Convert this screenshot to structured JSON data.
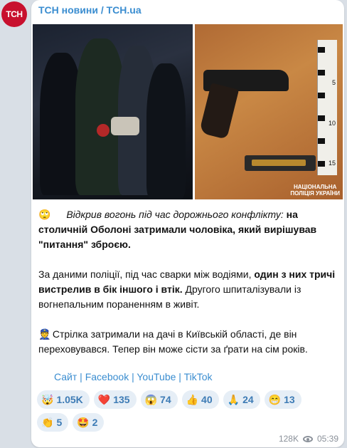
{
  "channel": {
    "avatar_text": "ТСН",
    "name": "ТСН новини / TCH.ua"
  },
  "photos": {
    "watermark": "НАЦІОНАЛЬНА\nПОЛІЦІЯ УКРАЇНИ",
    "ruler_marks": [
      "5",
      "10",
      "15"
    ]
  },
  "post": {
    "p1_emoji": "🙄",
    "p1_italic": "Відкрив вогонь під час дорожнього конфлікту:",
    "p1_bold": " на столичній Оболоні затримали чоловіка, який вирішував \"питання\" зброєю.",
    "p2_start": "За даними поліції, під час сварки між водіями, ",
    "p2_bold": "один з них тричі вистрелив в бік іншого і втік.",
    "p2_end": " Другого шпиталізували із вогнепальним пораненням в живіт.",
    "p3_emoji": "👮",
    "p3_text": " Стрілка затримали на дачі в Київській області, де він переховувався. Тепер він може сісти за ґрати на сім років."
  },
  "links": {
    "site": "Сайт",
    "facebook": "Facebook",
    "youtube": "YouTube",
    "tiktok": "TikTok",
    "separator": " | "
  },
  "reactions": [
    {
      "emoji": "🤯",
      "count": "1.05K"
    },
    {
      "emoji": "❤️",
      "count": "135"
    },
    {
      "emoji": "😱",
      "count": "74"
    },
    {
      "emoji": "👍",
      "count": "40"
    },
    {
      "emoji": "🙏",
      "count": "24"
    },
    {
      "emoji": "😁",
      "count": "13"
    },
    {
      "emoji": "👏",
      "count": "5"
    },
    {
      "emoji": "🤩",
      "count": "2"
    }
  ],
  "meta": {
    "views": "128K",
    "time": "05:39"
  }
}
